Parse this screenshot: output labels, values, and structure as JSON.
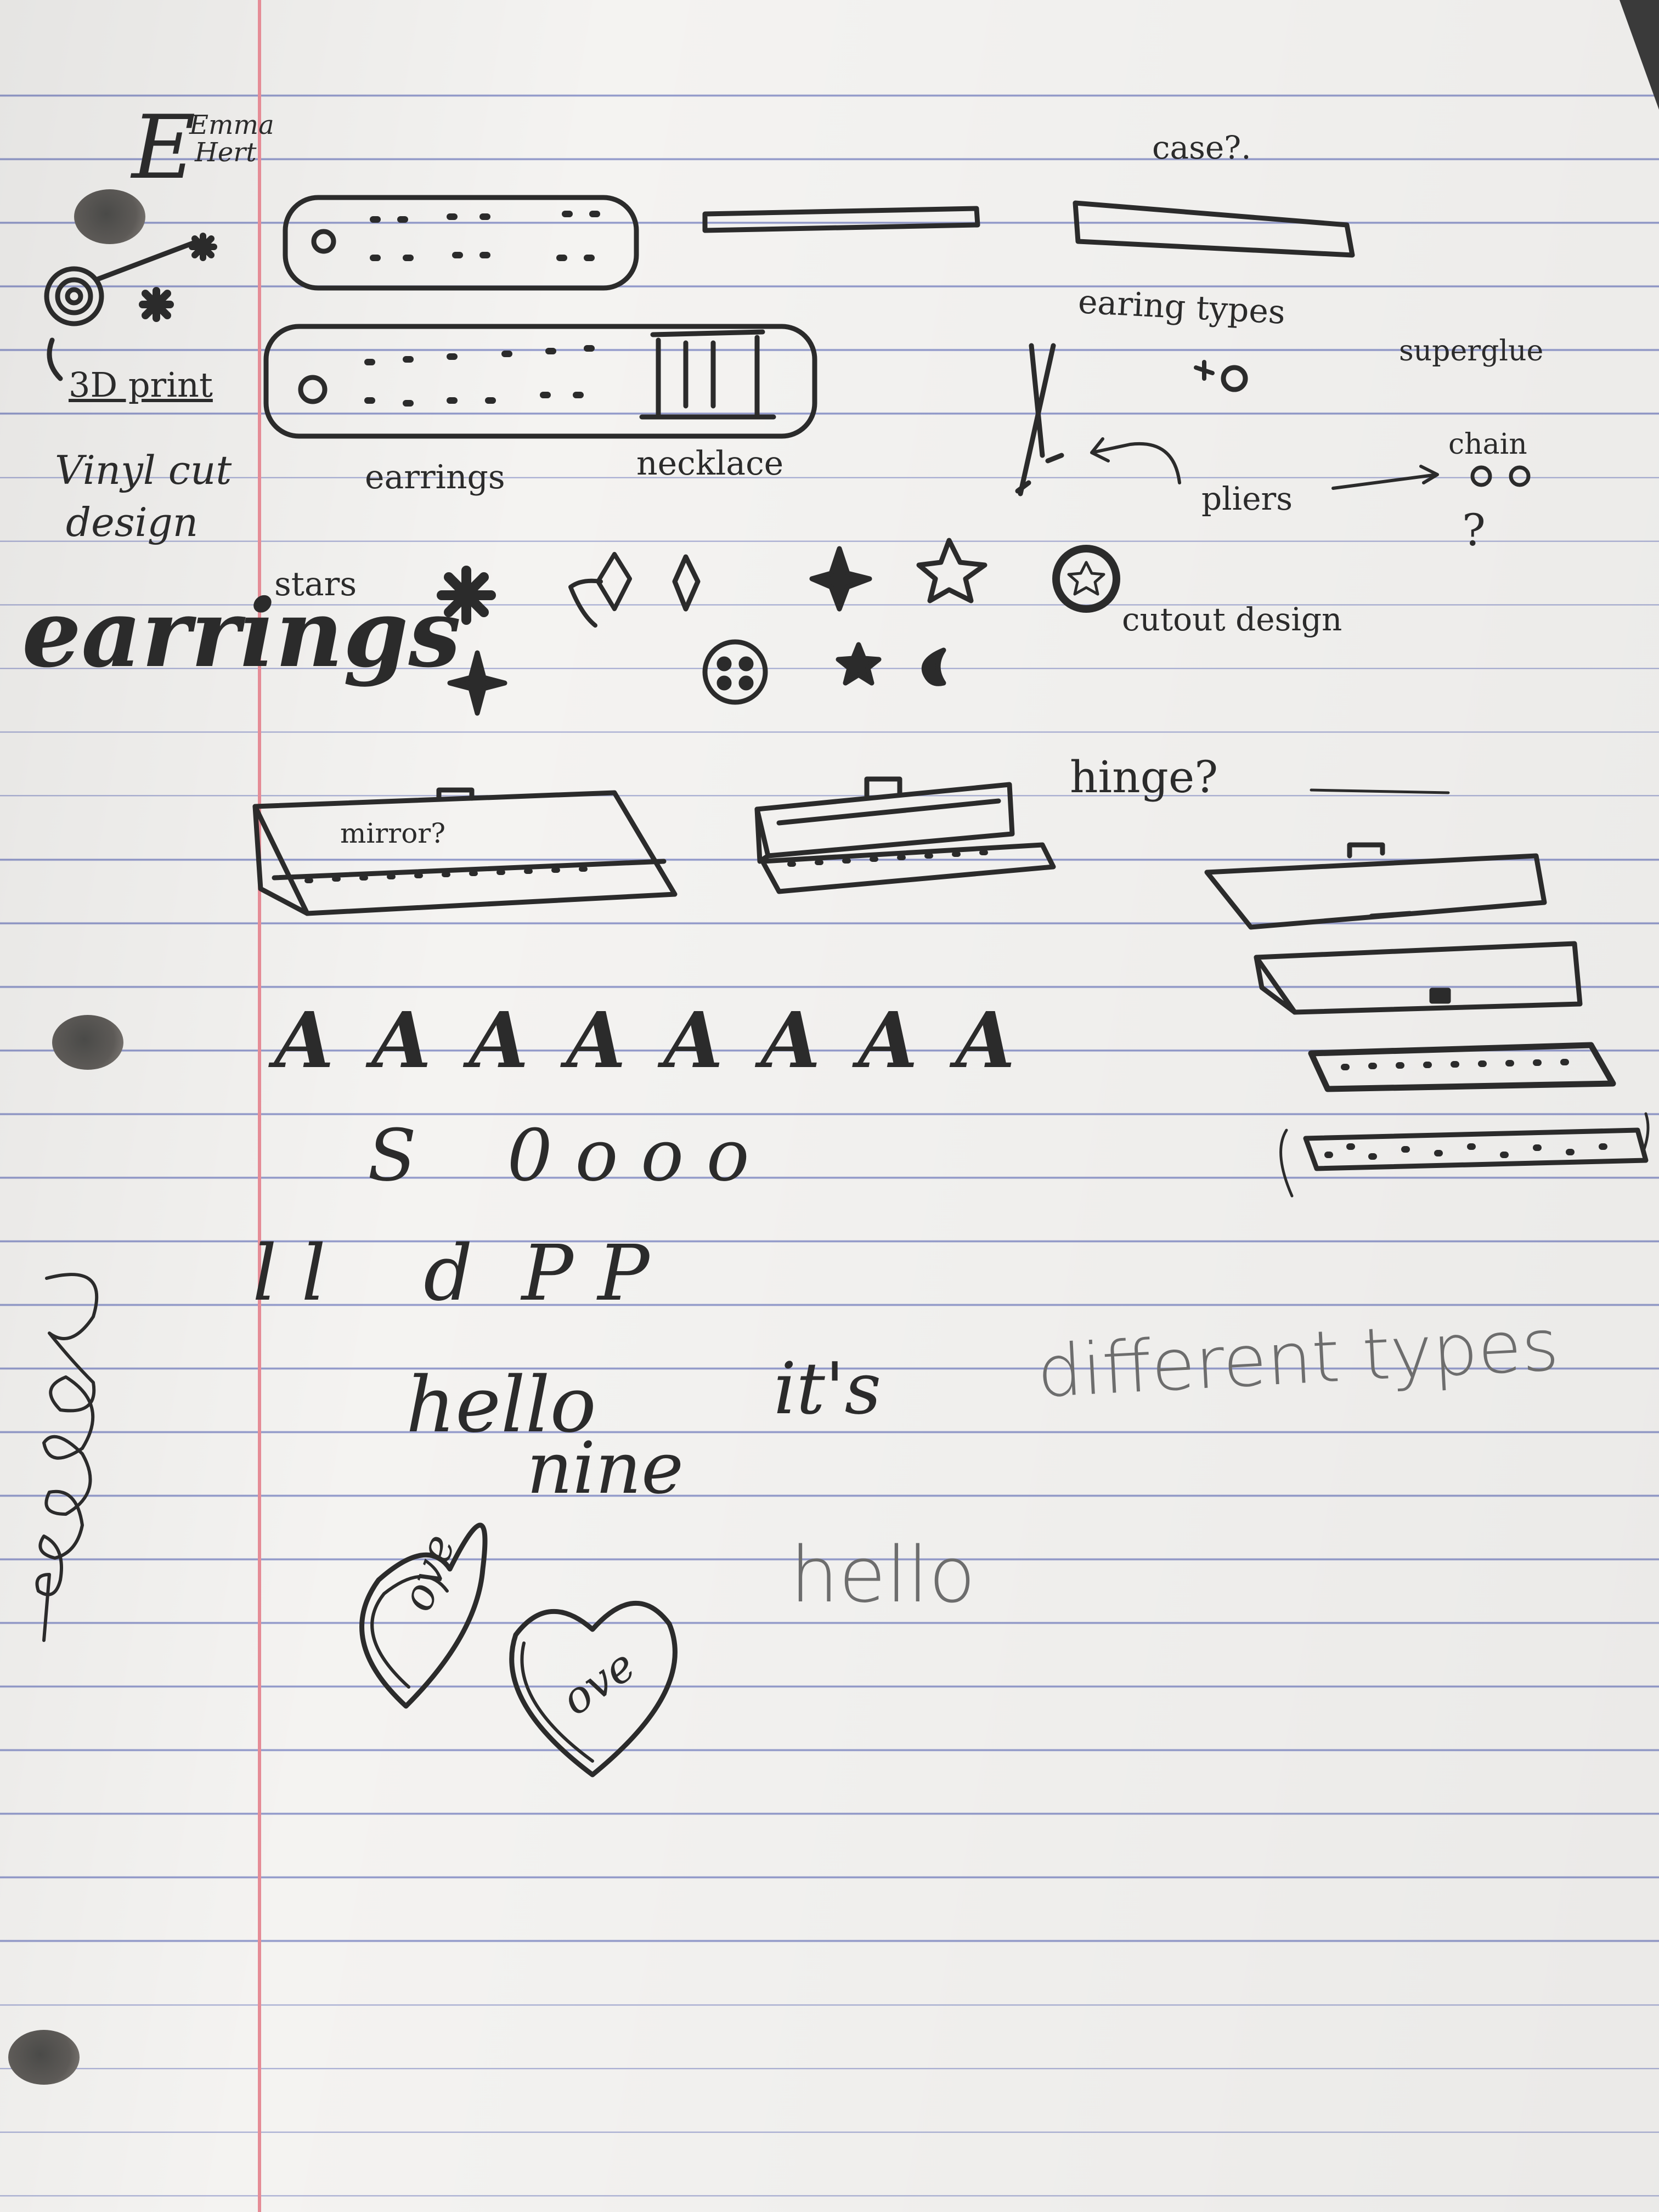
{
  "labels": {
    "author_line1": "Emma",
    "author_line2": "Hert",
    "case_q": "case?.",
    "earing_types": "earing types",
    "superglue": "superglue",
    "print_3d": "3D print",
    "vinyl_cut": "Vinyl cut",
    "design": "design",
    "earrings_small": "earrings",
    "necklace": "necklace",
    "chain": "chain",
    "pliers": "pliers",
    "question": "?",
    "stars": "stars",
    "earrings_big": "earrings",
    "cutout_design": "cutout design",
    "hinge": "hinge?",
    "mirror": "mirror?",
    "letters_a": "A A A A A A A A",
    "letters_s_o": "S    0 o o o",
    "letters_l_d_p": "l l    d  P P",
    "hello_cursive": "hello",
    "its": "it's",
    "nine": "nine",
    "different_types": "different types",
    "hello_print": "hello",
    "love_1": "ove",
    "love_2": "ove"
  },
  "colors": {
    "ink": "#2b2b2b",
    "pencil": "#6d6d6d",
    "paper": "#f4f3f1",
    "rule_line": "#8f97c9",
    "margin_line": "#e58c96"
  }
}
